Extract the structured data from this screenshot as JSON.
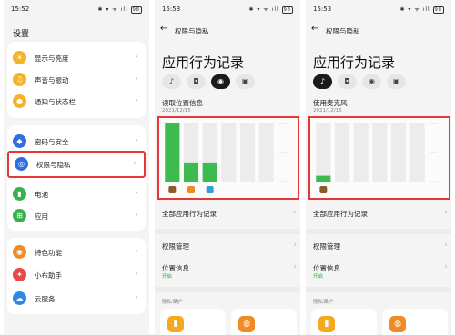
{
  "colors": {
    "accent_red": "#e5363a",
    "bar_green": "#3dbb4f",
    "grid_gray": "#ececec",
    "enabled_green": "#2fae4e"
  },
  "panel1": {
    "status": {
      "time": "15:52",
      "icons": "✱ ▾ ᯤ ıll",
      "battery": "98"
    },
    "title": "设置",
    "items": [
      {
        "label": "显示与亮度",
        "icon": "brightness-icon",
        "glyph": "☀",
        "color": "#f3b22a"
      },
      {
        "label": "声音与振动",
        "icon": "bell-icon",
        "glyph": "♫",
        "color": "#f3b22a"
      },
      {
        "label": "通知与状态栏",
        "icon": "notification-icon",
        "glyph": "●",
        "color": "#f3b22a"
      },
      {
        "label": "密码与安全",
        "icon": "shield-icon",
        "glyph": "◆",
        "color": "#2f6de0"
      },
      {
        "label": "权限与隐私",
        "icon": "privacy-icon",
        "glyph": "◎",
        "color": "#2f6de0"
      },
      {
        "label": "电池",
        "icon": "battery-icon",
        "glyph": "▮",
        "color": "#36b24a"
      },
      {
        "label": "应用",
        "icon": "apps-icon",
        "glyph": "⊞",
        "color": "#36b24a"
      },
      {
        "label": "特色功能",
        "icon": "star-icon",
        "glyph": "◉",
        "color": "#f08a24"
      },
      {
        "label": "小布助手",
        "icon": "assistant-icon",
        "glyph": "✦",
        "color": "#e8484a"
      },
      {
        "label": "云服务",
        "icon": "cloud-icon",
        "glyph": "☁",
        "color": "#2f88e6"
      }
    ]
  },
  "panel2": {
    "status": {
      "time": "15:53",
      "icons": "✱ ▾ ᯤ ıll",
      "battery": "98"
    },
    "nav_title": "权限与隐私",
    "big_title": "应用行为记录",
    "section_label": "读取位置信息",
    "date": "2021/12/15",
    "all_records": "全部应用行为记录",
    "permission_mgmt": "权限管理",
    "location_info": "位置信息",
    "location_status": "开启",
    "privacy_caption": "隐私保护"
  },
  "panel3": {
    "status": {
      "time": "15:53",
      "icons": "✱ ▾ ᯤ ıll",
      "battery": "98"
    },
    "nav_title": "权限与隐私",
    "big_title": "应用行为记录",
    "section_label": "使用麦克风",
    "date": "2021/12/15",
    "all_records": "全部应用行为记录",
    "permission_mgmt": "权限管理",
    "location_info": "位置信息",
    "location_status": "开启",
    "privacy_caption": "隐私保护"
  },
  "tabs": [
    {
      "icon": "microphone-icon",
      "glyph": "🎙"
    },
    {
      "icon": "camera-icon",
      "glyph": "◘"
    },
    {
      "icon": "location-icon",
      "glyph": "◉"
    },
    {
      "icon": "contacts-icon",
      "glyph": "▣"
    }
  ],
  "chart_data": [
    {
      "type": "bar",
      "title": "读取位置信息",
      "categories": [
        "app1",
        "app2",
        "app3",
        "",
        "",
        ""
      ],
      "values": [
        100,
        33,
        33,
        0,
        0,
        0
      ],
      "ylim": [
        0,
        100
      ]
    },
    {
      "type": "bar",
      "title": "使用麦克风",
      "categories": [
        "app1",
        "",
        "",
        "",
        "",
        ""
      ],
      "values": [
        10,
        0,
        0,
        0,
        0,
        0
      ],
      "ylim": [
        0,
        100
      ]
    }
  ]
}
